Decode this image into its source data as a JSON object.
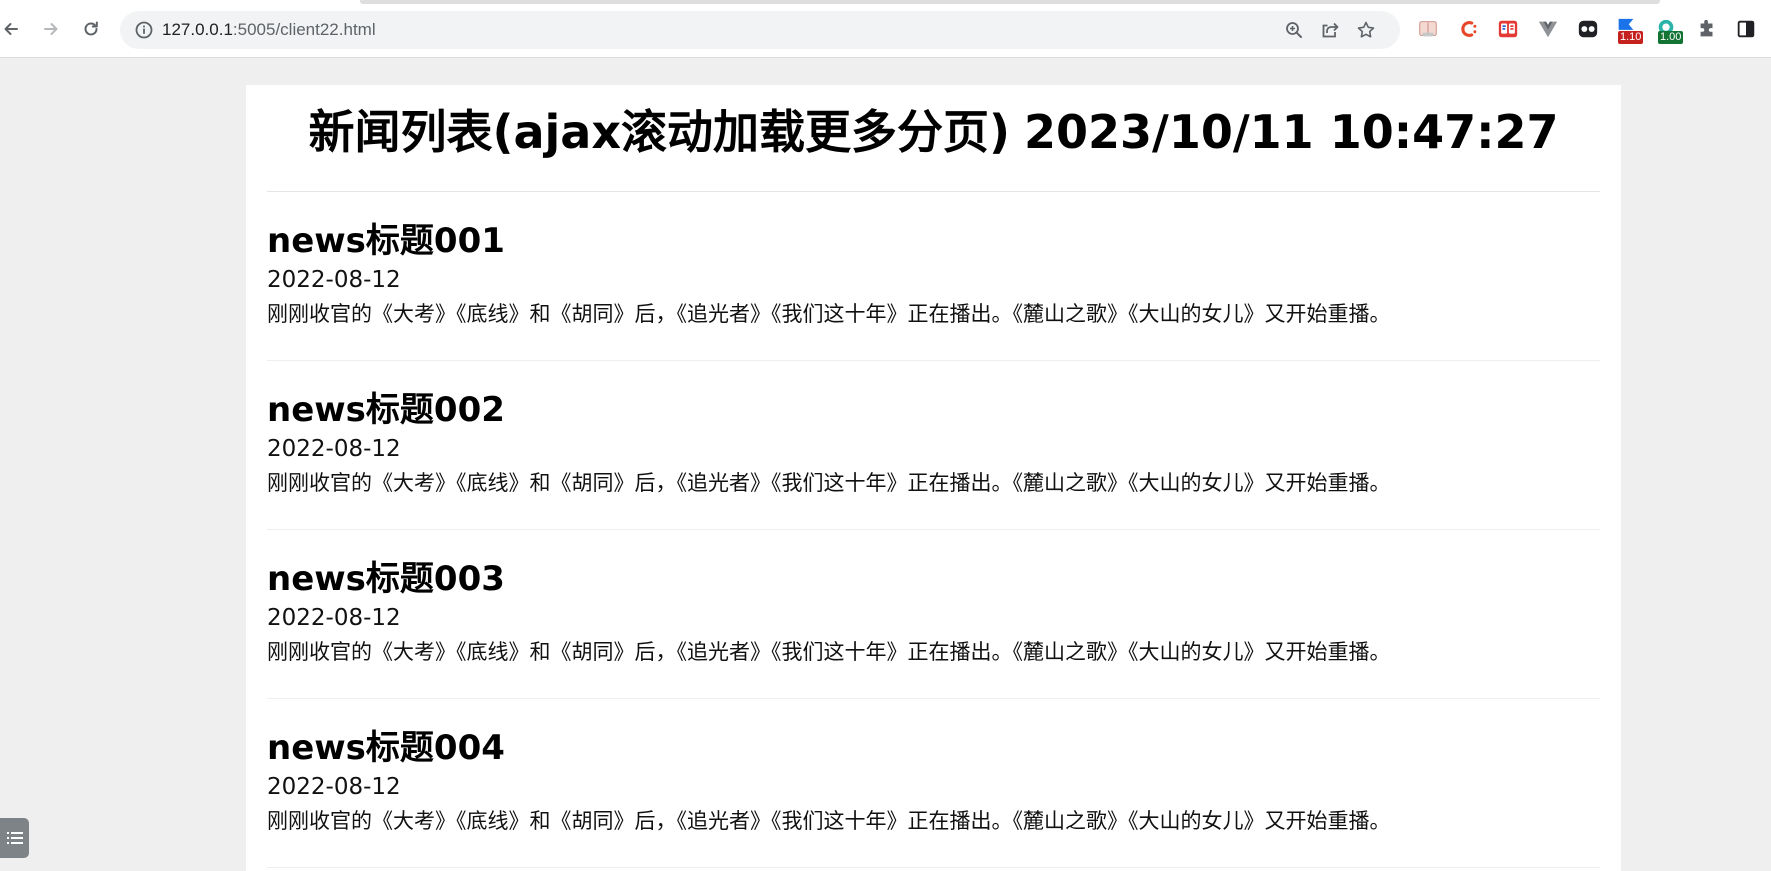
{
  "browser": {
    "url_host": "127.0.0.1",
    "url_rest": ":5005/client22.html",
    "extensions": [
      {
        "name": "ext-book-icon",
        "badge": ""
      },
      {
        "name": "ext-c-icon",
        "badge": ""
      },
      {
        "name": "ext-fe-icon",
        "badge": ""
      },
      {
        "name": "ext-vue-icon",
        "badge": ""
      },
      {
        "name": "ext-glasses-icon",
        "badge": ""
      },
      {
        "name": "ext-flag-icon",
        "badge": "1.10"
      },
      {
        "name": "ext-speed-icon",
        "badge": "1.00"
      }
    ]
  },
  "page": {
    "title": "新闻列表(ajax滚动加载更多分页)",
    "time": "2023/10/11 10:47:27"
  },
  "news": [
    {
      "title": "news标题001",
      "date": "2022-08-12",
      "summary": "刚刚收官的《大考》《底线》和《胡同》后，《追光者》《我们这十年》正在播出。《麓山之歌》《大山的女儿》又开始重播。"
    },
    {
      "title": "news标题002",
      "date": "2022-08-12",
      "summary": "刚刚收官的《大考》《底线》和《胡同》后，《追光者》《我们这十年》正在播出。《麓山之歌》《大山的女儿》又开始重播。"
    },
    {
      "title": "news标题003",
      "date": "2022-08-12",
      "summary": "刚刚收官的《大考》《底线》和《胡同》后，《追光者》《我们这十年》正在播出。《麓山之歌》《大山的女儿》又开始重播。"
    },
    {
      "title": "news标题004",
      "date": "2022-08-12",
      "summary": "刚刚收官的《大考》《底线》和《胡同》后，《追光者》《我们这十年》正在播出。《麓山之歌》《大山的女儿》又开始重播。"
    }
  ],
  "colors": {
    "ext_flag_badge": "#c5221f",
    "ext_speed_badge": "#137333"
  }
}
